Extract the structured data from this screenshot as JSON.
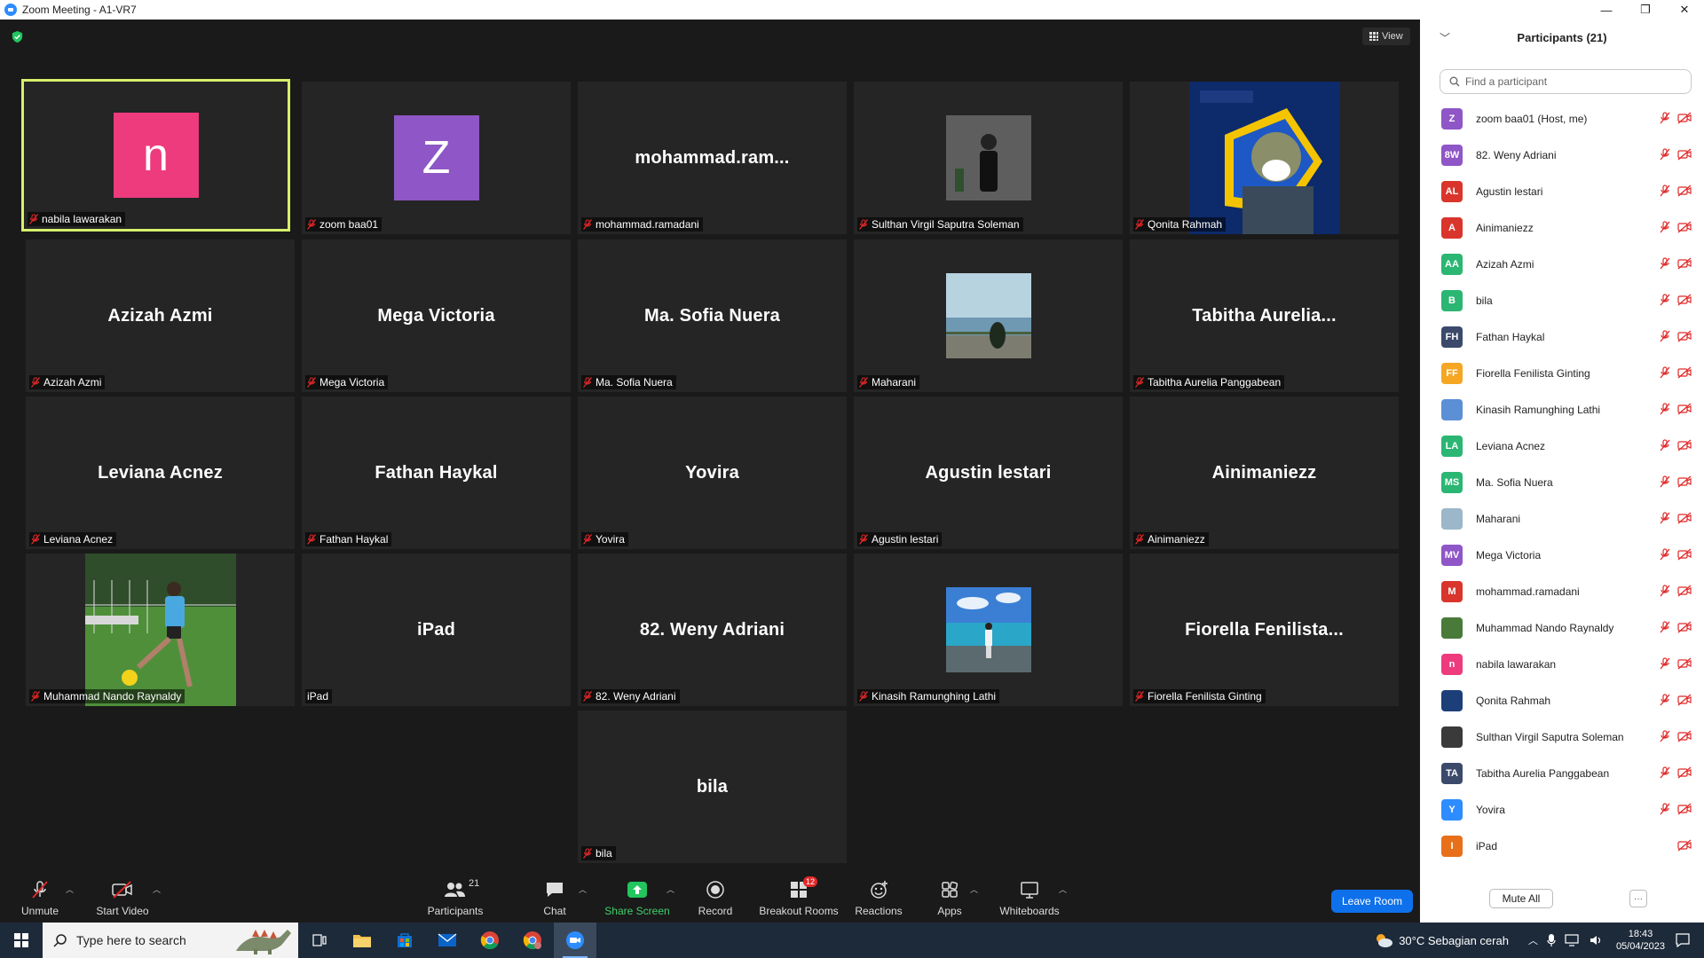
{
  "window": {
    "title": "Zoom Meeting - A1-VR7",
    "minimize": "—",
    "maximize": "❐",
    "close": "✕"
  },
  "view_button": {
    "label": "View"
  },
  "tiles": [
    {
      "display": "n",
      "label": "nabila lawarakan"
    },
    {
      "display": "Z",
      "label": "zoom baa01"
    },
    {
      "display": "mohammad.ram...",
      "label": "mohammad.ramadani"
    },
    {
      "display": "",
      "label": "Sulthan Virgil Saputra Soleman"
    },
    {
      "display": "",
      "label": "Qonita Rahmah"
    },
    {
      "display": "Azizah Azmi",
      "label": "Azizah Azmi"
    },
    {
      "display": "Mega Victoria",
      "label": "Mega Victoria"
    },
    {
      "display": "Ma. Sofia Nuera",
      "label": "Ma. Sofia Nuera"
    },
    {
      "display": "",
      "label": "Maharani"
    },
    {
      "display": "Tabitha  Aurelia...",
      "label": "Tabitha Aurelia Panggabean"
    },
    {
      "display": "Leviana Acnez",
      "label": "Leviana Acnez"
    },
    {
      "display": "Fathan Haykal",
      "label": "Fathan Haykal"
    },
    {
      "display": "Yovira",
      "label": "Yovira"
    },
    {
      "display": "Agustin lestari",
      "label": "Agustin lestari"
    },
    {
      "display": "Ainimaniezz",
      "label": "Ainimaniezz"
    },
    {
      "display": "",
      "label": "Muhammad Nando Raynaldy"
    },
    {
      "display": "iPad",
      "label": "iPad"
    },
    {
      "display": "82. Weny Adriani",
      "label": "82. Weny Adriani"
    },
    {
      "display": "",
      "label": "Kinasih Ramunghing Lathi"
    },
    {
      "display": "Fiorella  Fenilista...",
      "label": "Fiorella Fenilista Ginting"
    },
    {
      "display": "bila",
      "label": "bila"
    }
  ],
  "toolbar": {
    "unmute": "Unmute",
    "start_video": "Start Video",
    "participants": "Participants",
    "participants_count": "21",
    "chat": "Chat",
    "share_screen": "Share Screen",
    "record": "Record",
    "breakout_rooms": "Breakout Rooms",
    "breakout_badge": "12",
    "reactions": "Reactions",
    "apps": "Apps",
    "whiteboards": "Whiteboards",
    "leave_room": "Leave Room"
  },
  "panel": {
    "title": "Participants (21)",
    "search_placeholder": "Find a participant",
    "participants": [
      {
        "initials": "Z",
        "color": "#8e56c6",
        "name": "zoom baa01 (Host, me)"
      },
      {
        "initials": "8W",
        "color": "#8e56c6",
        "name": "82. Weny Adriani"
      },
      {
        "initials": "AL",
        "color": "#d9352c",
        "name": "Agustin lestari"
      },
      {
        "initials": "A",
        "color": "#d9352c",
        "name": "Ainimaniezz"
      },
      {
        "initials": "AA",
        "color": "#2bb673",
        "name": "Azizah Azmi"
      },
      {
        "initials": "B",
        "color": "#2bb673",
        "name": "bila"
      },
      {
        "initials": "FH",
        "color": "#3b4a6b",
        "name": "Fathan Haykal"
      },
      {
        "initials": "FF",
        "color": "#f5a623",
        "name": "Fiorella Fenilista Ginting"
      },
      {
        "initials": "",
        "color": "#5b8fd6",
        "name": "Kinasih Ramunghing Lathi"
      },
      {
        "initials": "LA",
        "color": "#2bb673",
        "name": "Leviana Acnez"
      },
      {
        "initials": "MS",
        "color": "#2bb673",
        "name": "Ma. Sofia Nuera"
      },
      {
        "initials": "",
        "color": "#9bb7c9",
        "name": "Maharani"
      },
      {
        "initials": "MV",
        "color": "#8e56c6",
        "name": "Mega Victoria"
      },
      {
        "initials": "M",
        "color": "#d9352c",
        "name": "mohammad.ramadani"
      },
      {
        "initials": "",
        "color": "#4a7a3a",
        "name": "Muhammad Nando Raynaldy"
      },
      {
        "initials": "n",
        "color": "#ee3b7d",
        "name": "nabila lawarakan"
      },
      {
        "initials": "",
        "color": "#1c3f7a",
        "name": "Qonita Rahmah"
      },
      {
        "initials": "",
        "color": "#3a3a3a",
        "name": "Sulthan Virgil Saputra Soleman"
      },
      {
        "initials": "TA",
        "color": "#3b4a6b",
        "name": "Tabitha Aurelia Panggabean"
      },
      {
        "initials": "Y",
        "color": "#2d8cff",
        "name": "Yovira"
      },
      {
        "initials": "I",
        "color": "#e8701a",
        "name": "iPad"
      }
    ],
    "mute_all": "Mute All",
    "more": "···"
  },
  "taskbar": {
    "search_placeholder": "Type here to search",
    "weather": "30°C  Sebagian cerah",
    "time": "18:43",
    "date": "05/04/2023"
  }
}
